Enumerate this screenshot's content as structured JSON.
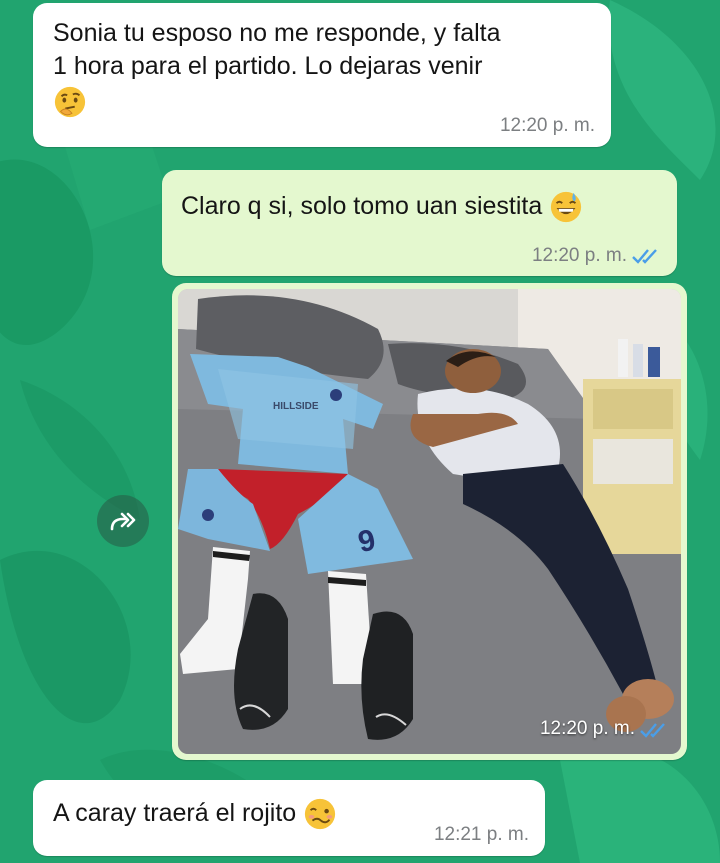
{
  "messages": [
    {
      "direction": "incoming",
      "line1": "Sonia tu esposo no me responde, y falta",
      "line2": "1 hora para el partido. Lo dejaras venir",
      "emoji": "thinking-face",
      "time": "12:20 p. m."
    },
    {
      "direction": "outgoing",
      "text": "Claro q si, solo tomo uan siestita",
      "emoji": "grinning-sweat-face",
      "time": "12:20 p. m.",
      "status": "read"
    },
    {
      "direction": "outgoing",
      "type": "photo",
      "jersey_text": "HILLSIDE",
      "shorts_number": "9",
      "time": "12:20 p. m.",
      "status": "read"
    },
    {
      "direction": "incoming",
      "text": "A caray traerá el rojito",
      "emoji": "woozy-face",
      "time": "12:21 p. m."
    }
  ],
  "forward_button": {
    "icon": "forward-icon"
  },
  "colors": {
    "wallpaper": "#21a46f",
    "incoming_bubble": "#ffffff",
    "outgoing_bubble": "#e4f8cf",
    "read_ticks": "#4a9ee8"
  }
}
